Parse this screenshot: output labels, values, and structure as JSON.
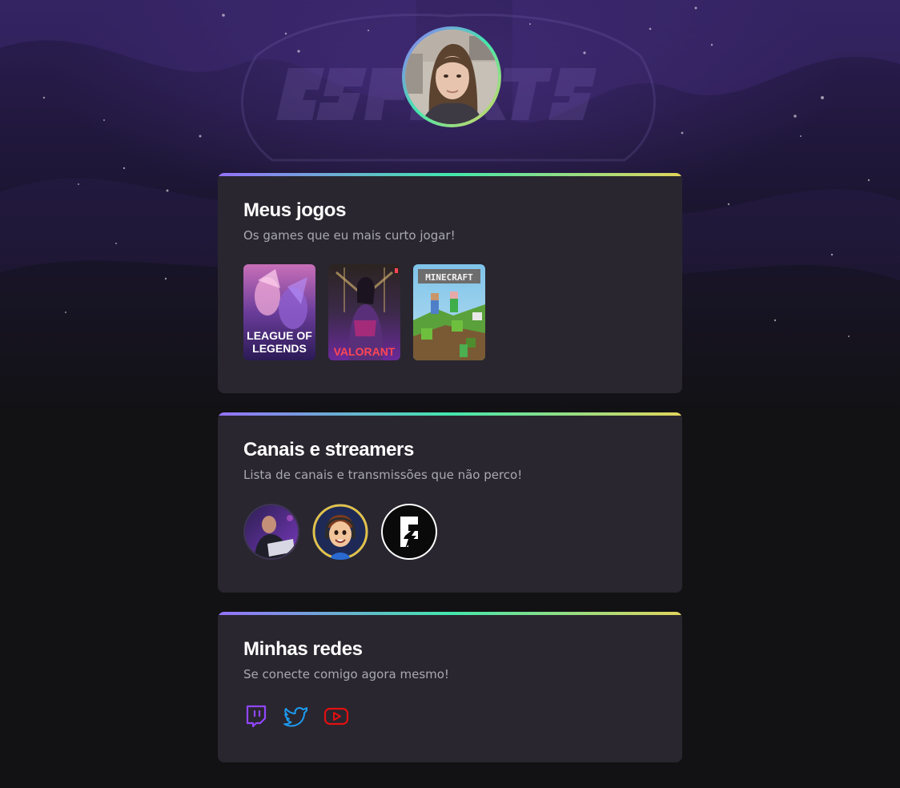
{
  "profile": {
    "avatar_alt": "Foto de perfil",
    "background_text": "ESPORTS"
  },
  "cards": {
    "games": {
      "title": "Meus jogos",
      "subtitle": "Os games que eu mais curto jogar!",
      "items": [
        {
          "name": "LEAGUE OF LEGENDS",
          "line1": "LEAGUE OF",
          "line2": "LEGENDS"
        },
        {
          "name": "VALORANT"
        },
        {
          "name": "MINECRAFT"
        }
      ]
    },
    "streamers": {
      "title": "Canais e streamers",
      "subtitle": "Lista de canais e transmissões que não perco!",
      "items": [
        {
          "name": "streamer-1"
        },
        {
          "name": "streamer-2"
        },
        {
          "name": "streamer-3"
        }
      ]
    },
    "socials": {
      "title": "Minhas redes",
      "subtitle": "Se conecte comigo agora mesmo!",
      "items": [
        {
          "name": "twitch",
          "icon": "twitch-icon",
          "color": "#9146ff"
        },
        {
          "name": "twitter",
          "icon": "twitter-icon",
          "color": "#1d9bf0"
        },
        {
          "name": "youtube",
          "icon": "youtube-icon",
          "color": "#e31010"
        }
      ]
    }
  },
  "colors": {
    "background": "#121214",
    "card": "#29262f",
    "gradient": [
      "#9572fc",
      "#43e7ad",
      "#e2d45c"
    ]
  }
}
